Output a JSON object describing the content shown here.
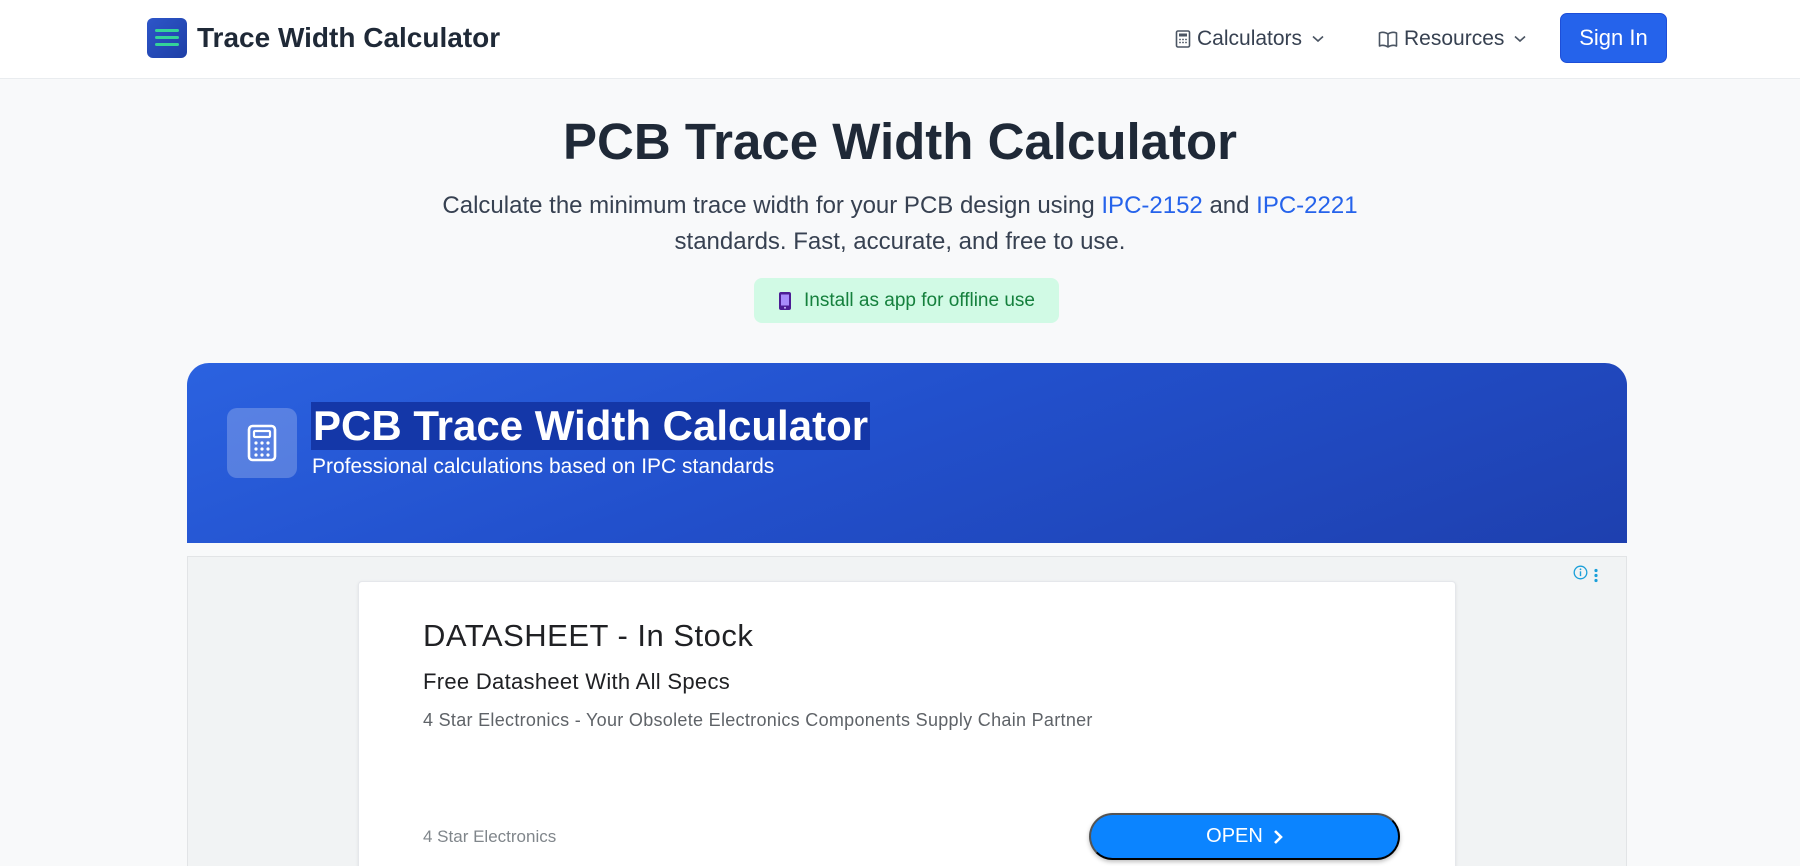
{
  "navbar": {
    "brand_name": "Trace Width Calculator",
    "links": [
      {
        "label": "Calculators",
        "icon": "calculator-icon"
      },
      {
        "label": "Resources",
        "icon": "book-icon"
      }
    ],
    "signin_label": "Sign In"
  },
  "hero": {
    "title": "PCB Trace Width Calculator",
    "subtitle_before": "Calculate the minimum trace width for your PCB design using ",
    "link1": "IPC-2152",
    "subtitle_mid": " and ",
    "link2": "IPC-2221",
    "subtitle_after": " standards. Fast, accurate, and free to use.",
    "install_label": "Install as app for offline use"
  },
  "card": {
    "title": "PCB Trace Width Calculator",
    "subtitle": "Professional calculations based on IPC standards"
  },
  "ad": {
    "title": "DATASHEET - In Stock",
    "headline": "Free Datasheet With All Specs",
    "description": "4 Star Electronics - Your Obsolete Electronics Components Supply Chain Partner",
    "advertiser": "4 Star Electronics",
    "cta_label": "OPEN"
  },
  "colors": {
    "primary": "#2563eb",
    "install_bg": "#d1fae5",
    "install_text": "#15803d",
    "card_gradient_start": "#2b62e0",
    "card_gradient_end": "#1e40af",
    "ad_button": "#0b84ff"
  }
}
